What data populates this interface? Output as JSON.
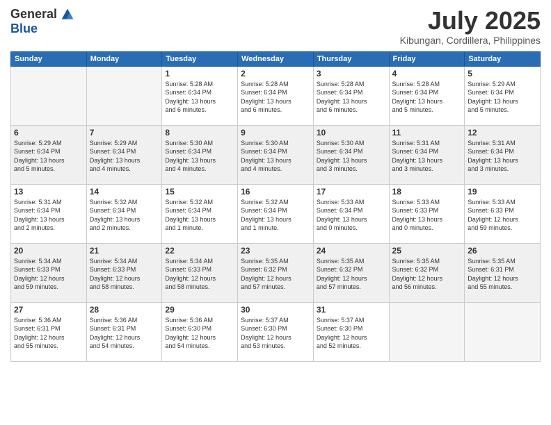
{
  "logo": {
    "general": "General",
    "blue": "Blue"
  },
  "header": {
    "month": "July 2025",
    "location": "Kibungan, Cordillera, Philippines"
  },
  "weekdays": [
    "Sunday",
    "Monday",
    "Tuesday",
    "Wednesday",
    "Thursday",
    "Friday",
    "Saturday"
  ],
  "weeks": [
    [
      {
        "day": "",
        "info": ""
      },
      {
        "day": "",
        "info": ""
      },
      {
        "day": "1",
        "info": "Sunrise: 5:28 AM\nSunset: 6:34 PM\nDaylight: 13 hours\nand 6 minutes."
      },
      {
        "day": "2",
        "info": "Sunrise: 5:28 AM\nSunset: 6:34 PM\nDaylight: 13 hours\nand 6 minutes."
      },
      {
        "day": "3",
        "info": "Sunrise: 5:28 AM\nSunset: 6:34 PM\nDaylight: 13 hours\nand 6 minutes."
      },
      {
        "day": "4",
        "info": "Sunrise: 5:28 AM\nSunset: 6:34 PM\nDaylight: 13 hours\nand 5 minutes."
      },
      {
        "day": "5",
        "info": "Sunrise: 5:29 AM\nSunset: 6:34 PM\nDaylight: 13 hours\nand 5 minutes."
      }
    ],
    [
      {
        "day": "6",
        "info": "Sunrise: 5:29 AM\nSunset: 6:34 PM\nDaylight: 13 hours\nand 5 minutes."
      },
      {
        "day": "7",
        "info": "Sunrise: 5:29 AM\nSunset: 6:34 PM\nDaylight: 13 hours\nand 4 minutes."
      },
      {
        "day": "8",
        "info": "Sunrise: 5:30 AM\nSunset: 6:34 PM\nDaylight: 13 hours\nand 4 minutes."
      },
      {
        "day": "9",
        "info": "Sunrise: 5:30 AM\nSunset: 6:34 PM\nDaylight: 13 hours\nand 4 minutes."
      },
      {
        "day": "10",
        "info": "Sunrise: 5:30 AM\nSunset: 6:34 PM\nDaylight: 13 hours\nand 3 minutes."
      },
      {
        "day": "11",
        "info": "Sunrise: 5:31 AM\nSunset: 6:34 PM\nDaylight: 13 hours\nand 3 minutes."
      },
      {
        "day": "12",
        "info": "Sunrise: 5:31 AM\nSunset: 6:34 PM\nDaylight: 13 hours\nand 3 minutes."
      }
    ],
    [
      {
        "day": "13",
        "info": "Sunrise: 5:31 AM\nSunset: 6:34 PM\nDaylight: 13 hours\nand 2 minutes."
      },
      {
        "day": "14",
        "info": "Sunrise: 5:32 AM\nSunset: 6:34 PM\nDaylight: 13 hours\nand 2 minutes."
      },
      {
        "day": "15",
        "info": "Sunrise: 5:32 AM\nSunset: 6:34 PM\nDaylight: 13 hours\nand 1 minute."
      },
      {
        "day": "16",
        "info": "Sunrise: 5:32 AM\nSunset: 6:34 PM\nDaylight: 13 hours\nand 1 minute."
      },
      {
        "day": "17",
        "info": "Sunrise: 5:33 AM\nSunset: 6:34 PM\nDaylight: 13 hours\nand 0 minutes."
      },
      {
        "day": "18",
        "info": "Sunrise: 5:33 AM\nSunset: 6:33 PM\nDaylight: 13 hours\nand 0 minutes."
      },
      {
        "day": "19",
        "info": "Sunrise: 5:33 AM\nSunset: 6:33 PM\nDaylight: 12 hours\nand 59 minutes."
      }
    ],
    [
      {
        "day": "20",
        "info": "Sunrise: 5:34 AM\nSunset: 6:33 PM\nDaylight: 12 hours\nand 59 minutes."
      },
      {
        "day": "21",
        "info": "Sunrise: 5:34 AM\nSunset: 6:33 PM\nDaylight: 12 hours\nand 58 minutes."
      },
      {
        "day": "22",
        "info": "Sunrise: 5:34 AM\nSunset: 6:33 PM\nDaylight: 12 hours\nand 58 minutes."
      },
      {
        "day": "23",
        "info": "Sunrise: 5:35 AM\nSunset: 6:32 PM\nDaylight: 12 hours\nand 57 minutes."
      },
      {
        "day": "24",
        "info": "Sunrise: 5:35 AM\nSunset: 6:32 PM\nDaylight: 12 hours\nand 57 minutes."
      },
      {
        "day": "25",
        "info": "Sunrise: 5:35 AM\nSunset: 6:32 PM\nDaylight: 12 hours\nand 56 minutes."
      },
      {
        "day": "26",
        "info": "Sunrise: 5:35 AM\nSunset: 6:31 PM\nDaylight: 12 hours\nand 55 minutes."
      }
    ],
    [
      {
        "day": "27",
        "info": "Sunrise: 5:36 AM\nSunset: 6:31 PM\nDaylight: 12 hours\nand 55 minutes."
      },
      {
        "day": "28",
        "info": "Sunrise: 5:36 AM\nSunset: 6:31 PM\nDaylight: 12 hours\nand 54 minutes."
      },
      {
        "day": "29",
        "info": "Sunrise: 5:36 AM\nSunset: 6:30 PM\nDaylight: 12 hours\nand 54 minutes."
      },
      {
        "day": "30",
        "info": "Sunrise: 5:37 AM\nSunset: 6:30 PM\nDaylight: 12 hours\nand 53 minutes."
      },
      {
        "day": "31",
        "info": "Sunrise: 5:37 AM\nSunset: 6:30 PM\nDaylight: 12 hours\nand 52 minutes."
      },
      {
        "day": "",
        "info": ""
      },
      {
        "day": "",
        "info": ""
      }
    ]
  ]
}
